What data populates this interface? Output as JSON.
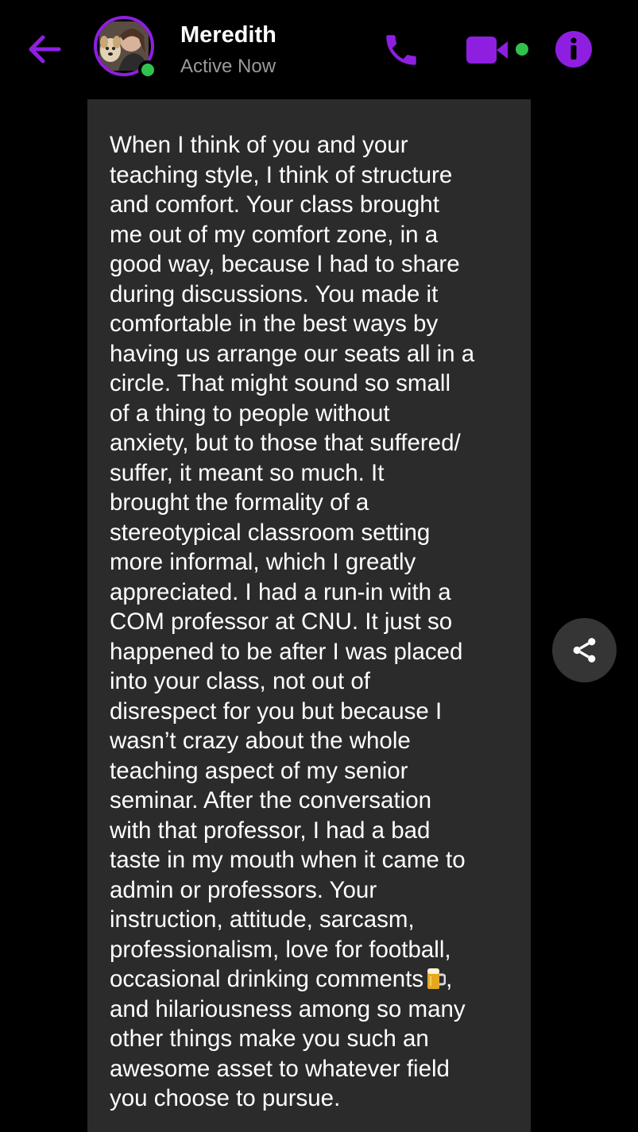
{
  "header": {
    "contact_name": "Meredith",
    "status": "Active Now",
    "online": true,
    "accent_color": "#8f1fe0",
    "online_color": "#31c24d",
    "icons": {
      "back": "arrow-left-icon",
      "call": "phone-icon",
      "video": "video-camera-icon",
      "info": "info-icon"
    }
  },
  "message": {
    "text_before_emoji": "When I think of you and your\nteaching style, I think of structure\nand comfort. Your class brought\nme out of my comfort zone, in a\ngood way, because I had to share\nduring discussions. You made it\ncomfortable in the best ways by\nhaving us arrange our seats all in a\ncircle. That might sound so small\nof a thing to people without\nanxiety, but to those that suffered/\nsuffer, it meant so much. It\nbrought the formality of a\nstereotypical classroom setting\nmore informal, which I greatly\nappreciated. I had a run-in with a\nCOM professor at CNU. It just so\nhappened to be after I was placed\ninto your class, not out of\ndisrespect for you but because I\nwasn’t crazy about the whole\nteaching aspect of my senior\nseminar. After the conversation\nwith that professor, I had a bad\ntaste in my mouth when it came to\nadmin or professors. Your\ninstruction, attitude, sarcasm,\nprofessionalism, love for football,\noccasional drinking comments",
    "emoji": "beer-mug-icon",
    "text_after_emoji": ",\nand hilariousness among so many\nother things make you such an\nawesome asset to whatever field\nyou choose to pursue.",
    "bubble_color": "#2b2b2b"
  },
  "actions": {
    "share_icon": "share-icon"
  }
}
